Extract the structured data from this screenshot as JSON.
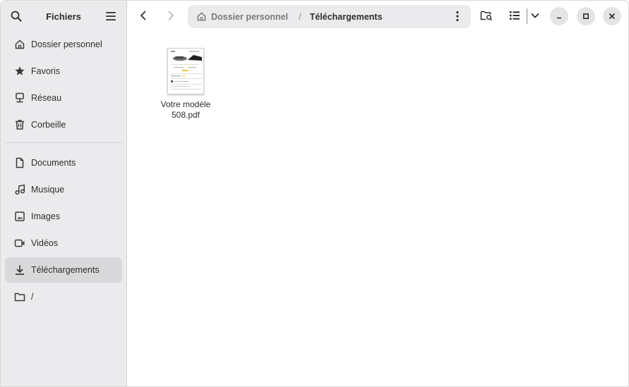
{
  "sidebar": {
    "title": "Fichiers",
    "places": [
      {
        "label": "Dossier personnel",
        "icon": "home-icon"
      },
      {
        "label": "Favoris",
        "icon": "star-icon"
      },
      {
        "label": "Réseau",
        "icon": "network-icon"
      },
      {
        "label": "Corbeille",
        "icon": "trash-icon"
      }
    ],
    "bookmarks": [
      {
        "label": "Documents",
        "icon": "document-icon"
      },
      {
        "label": "Musique",
        "icon": "music-icon"
      },
      {
        "label": "Images",
        "icon": "image-icon"
      },
      {
        "label": "Vidéos",
        "icon": "video-icon"
      },
      {
        "label": "Téléchargements",
        "icon": "download-icon",
        "active": true
      },
      {
        "label": "/",
        "icon": "folder-icon"
      }
    ]
  },
  "pathbar": {
    "crumbs": [
      "Dossier personnel",
      "Téléchargements"
    ],
    "separator": "/"
  },
  "files": [
    {
      "name": "Votre modèle\n508.pdf",
      "type": "pdf"
    }
  ],
  "colors": {
    "sidebar_bg": "#ebebed",
    "active_item_bg": "#d9d9db",
    "pathbar_bg": "#ebebed",
    "window_button_bg": "#e4e4e6"
  }
}
